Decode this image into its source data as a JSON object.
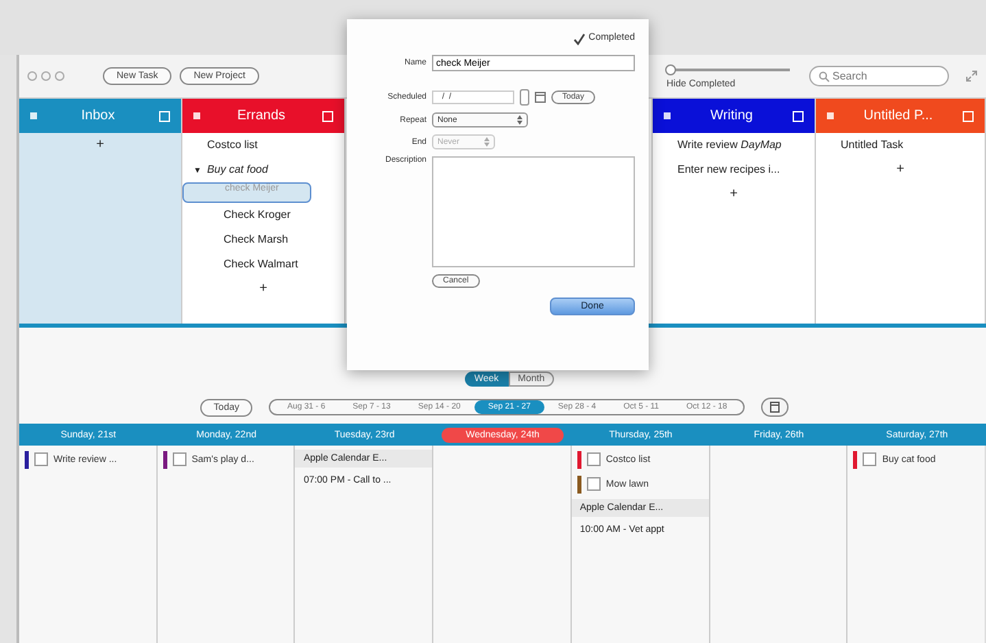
{
  "toolbar": {
    "buttons": [
      "New Task",
      "New Project"
    ],
    "hide_completed": {
      "label": "Hide Completed",
      "level": 0
    },
    "search": {
      "placeholder": "Search"
    }
  },
  "projects": [
    {
      "name": "Inbox",
      "color": "#1a8fc0",
      "tint": true,
      "add": "+"
    },
    {
      "name": "Errands",
      "color": "#e8102a",
      "tint": false,
      "items": [
        {
          "text": "Costco list",
          "italic": false,
          "selected": false,
          "completed": false
        },
        {
          "text": "Buy cat food",
          "italic": true,
          "expanded": true,
          "toggle": "▼",
          "selected": false,
          "completed": false,
          "children": [
            {
              "text": "check Meijer",
              "italic": false,
              "selected": true,
              "completed": true
            },
            {
              "text": "Check Kroger",
              "italic": false,
              "selected": false,
              "completed": false
            },
            {
              "text": "Check Marsh",
              "italic": false,
              "selected": false,
              "completed": false
            },
            {
              "text": "Check Walmart",
              "italic": false,
              "selected": false,
              "completed": false
            }
          ],
          "add": "+"
        }
      ]
    },
    {
      "kind": "hidden"
    },
    {
      "name": "Writing",
      "color": "#0a10d8",
      "tint": false,
      "items": [
        {
          "text": "Write review *DayMap*",
          "italic": false,
          "selected": false,
          "completed": false
        },
        {
          "text": "Enter new recipes i...",
          "italic": false,
          "selected": false,
          "completed": false
        }
      ],
      "add": "+"
    },
    {
      "name": "Untitled P...",
      "color": "#f04a1e",
      "tint": false,
      "items": [
        {
          "text": "Untitled Task",
          "italic": false,
          "selected": false,
          "completed": false
        }
      ],
      "add": "+"
    }
  ],
  "dialog": {
    "completed": {
      "label": "Completed",
      "checked": true
    },
    "name": {
      "label": "Name",
      "value": "check Meijer"
    },
    "scheduled": {
      "label": "Scheduled",
      "value": "  /  /",
      "today": "Today"
    },
    "repeat": {
      "label": "Repeat",
      "value": "None"
    },
    "end": {
      "label": "End",
      "value": "Never",
      "disabled": true
    },
    "description": {
      "label": "Description"
    },
    "cancel": "Cancel",
    "done": "Done"
  },
  "view_switch": [
    {
      "label": "Week",
      "selected": true
    },
    {
      "label": "Month",
      "selected": false
    }
  ],
  "week_nav": {
    "today": "Today",
    "weeks": [
      {
        "label": "Aug 31 - 6",
        "selected": false
      },
      {
        "label": "Sep 7 - 13",
        "selected": false
      },
      {
        "label": "Sep 14 - 20",
        "selected": false
      },
      {
        "label": "Sep 21 - 27",
        "selected": true
      },
      {
        "label": "Sep 28 - 4",
        "selected": false
      },
      {
        "label": "Oct 5 - 11",
        "selected": false
      },
      {
        "label": "Oct 12 - 18",
        "selected": false
      }
    ]
  },
  "days": [
    {
      "label": "Sunday, 21st",
      "today": false,
      "entries": [
        {
          "kind": "task",
          "text": "Write review ...",
          "color": "#2a1f9e",
          "checked": false
        }
      ]
    },
    {
      "label": "Monday, 22nd",
      "today": false,
      "entries": [
        {
          "kind": "task",
          "text": "Sam's play d...",
          "color": "#7a1a80",
          "checked": false
        }
      ]
    },
    {
      "label": "Tuesday, 23rd",
      "today": false,
      "entries": [
        {
          "kind": "event",
          "text": "Apple Calendar E..."
        },
        {
          "kind": "timed",
          "text": "07:00 PM - Call to ..."
        }
      ]
    },
    {
      "label": "Wednesday, 24th",
      "today": true
    },
    {
      "label": "Thursday, 25th",
      "today": false,
      "entries": [
        {
          "kind": "task",
          "text": "Costco list",
          "color": "#e01830",
          "checked": false
        },
        {
          "kind": "task",
          "text": "Mow lawn",
          "color": "#8a5a20",
          "checked": false
        },
        {
          "kind": "event",
          "text": "Apple Calendar E..."
        },
        {
          "kind": "timed",
          "text": "10:00 AM - Vet appt"
        }
      ]
    },
    {
      "label": "Friday, 26th",
      "today": false
    },
    {
      "label": "Saturday, 27th",
      "today": false,
      "entries": [
        {
          "kind": "task",
          "text": "Buy cat food",
          "color": "#e01830",
          "checked": false
        }
      ]
    }
  ]
}
